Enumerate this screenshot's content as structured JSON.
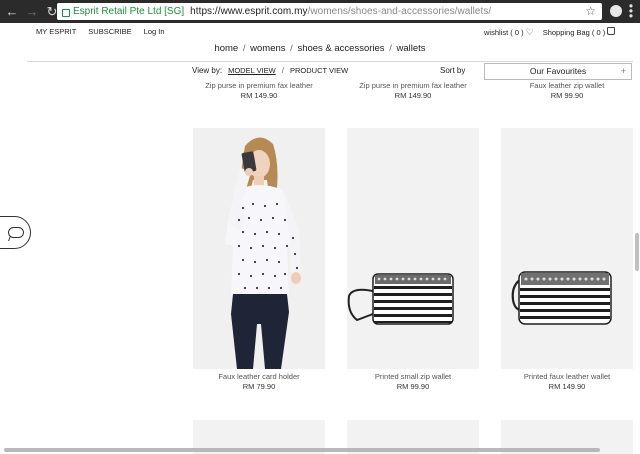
{
  "browser": {
    "secure_label": "Esprit Retail Pte Ltd [SG]",
    "url_base": "https://www.esprit.com.my",
    "url_path": "/womens/shoes-and-accessories/wallets/"
  },
  "topbar": {
    "links": [
      "MY ESPRIT",
      "SUBSCRIBE",
      "Log In"
    ],
    "wishlist": "wishlist ( 0 )",
    "bag": "Shopping Bag ( 0 )"
  },
  "breadcrumb": [
    "home",
    "womens",
    "shoes & accessories",
    "wallets"
  ],
  "viewbar": {
    "label": "View by:",
    "model_view": "MODEL VIEW",
    "separator": "/",
    "product_view": "PRODUCT VIEW",
    "sort_label": "Sort by",
    "sort_value": "Our Favourites"
  },
  "previous_row": [
    {
      "name": "Zip purse in premium fax leather",
      "price": "RM 149.90"
    },
    {
      "name": "Zip purse in premium fax leather",
      "price": "RM 149.90"
    },
    {
      "name": "Faux leather zip wallet",
      "price": "RM 99.90"
    }
  ],
  "products": [
    {
      "name": "Faux leather card holder",
      "price": "RM 79.90"
    },
    {
      "name": "Printed small zip wallet",
      "price": "RM 99.90"
    },
    {
      "name": "Printed faux leather wallet",
      "price": "RM 149.90"
    }
  ],
  "icons": {
    "back": "arrow-left-icon",
    "forward": "arrow-right-icon",
    "reload": "reload-icon",
    "lock": "lock-icon",
    "bookmark": "star-icon",
    "wishlist": "heart-icon",
    "bag": "shopping-bag-icon",
    "chat": "chat-bubble-icon"
  }
}
